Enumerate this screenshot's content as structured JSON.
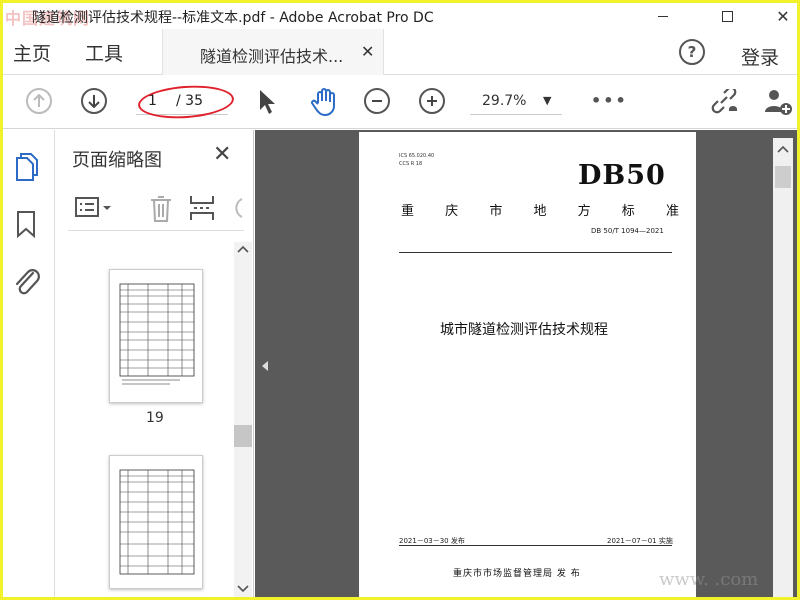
{
  "window": {
    "title": "隧道检测评估技术规程--标准文本.pdf - Adobe Acrobat Pro DC",
    "watermark_top": "中国建筑网",
    "close_glyph": "✕"
  },
  "tabs": {
    "home": "主页",
    "tools": "工具",
    "doc_tab": "隧道检测评估技术...",
    "doc_tab_close": "✕",
    "help": "?",
    "login": "登录"
  },
  "toolbar": {
    "current_page": "1",
    "total_pages": "/ 35",
    "zoom": "29.7%",
    "zoom_caret": "▼",
    "more": "•••",
    "annotation_color": "#e0202a"
  },
  "panel": {
    "title": "页面缩略图",
    "close": "✕",
    "thumbnail_page_label": "19"
  },
  "document": {
    "ics_line1": "ICS 65.020.40",
    "ics_line2": "CCS  R  18",
    "db_code": "DB50",
    "std_chars": [
      "重",
      "庆",
      "市",
      "地",
      "方",
      "标",
      "准"
    ],
    "std_number": "DB 50/T  1094—2021",
    "doc_title": "城市隧道检测评估技术规程",
    "publish_date": "2021－03－30 发布",
    "effective_date": "2021－07－01 实施",
    "issuer": "重庆市市场监督管理局   发 布"
  },
  "watermark_bottom": "www.   .com",
  "colors": {
    "frame": "#f2f22a",
    "doc_bg": "#5a5a5a",
    "icon_blue": "#2c6cc6"
  }
}
